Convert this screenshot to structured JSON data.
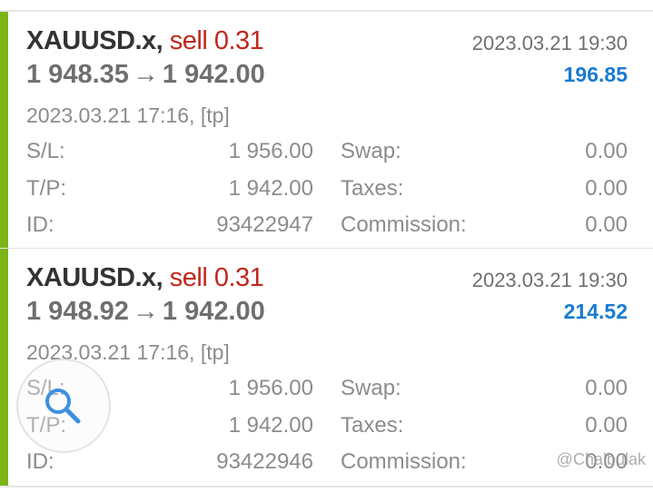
{
  "trades": [
    {
      "symbol": "XAUUSD.x,",
      "side": "sell 0.31",
      "close_time": "2023.03.21 19:30",
      "open_price": "1 948.35",
      "arrow": "→",
      "close_price": "1 942.00",
      "profit": "196.85",
      "open_info": "2023.03.21 17:16, [tp]",
      "sl_label": "S/L:",
      "sl_value": "1 956.00",
      "tp_label": "T/P:",
      "tp_value": "1 942.00",
      "id_label": "ID:",
      "id_value": "93422947",
      "swap_label": "Swap:",
      "swap_value": "0.00",
      "taxes_label": "Taxes:",
      "taxes_value": "0.00",
      "commission_label": "Commission:",
      "commission_value": "0.00"
    },
    {
      "symbol": "XAUUSD.x,",
      "side": "sell 0.31",
      "close_time": "2023.03.21 19:30",
      "open_price": "1 948.92",
      "arrow": "→",
      "close_price": "1 942.00",
      "profit": "214.52",
      "open_info": "2023.03.21 17:16, [tp]",
      "sl_label": "S/L:",
      "sl_value": "1 956.00",
      "tp_label": "T/P:",
      "tp_value": "1 942.00",
      "id_label": "ID:",
      "id_value": "93422946",
      "swap_label": "Swap:",
      "swap_value": "0.00",
      "taxes_label": "Taxes:",
      "taxes_value": "0.00",
      "commission_label": "Commission:",
      "commission_value": "0.00"
    }
  ],
  "watermark": "@Chalbulak",
  "colors": {
    "accent": "#7cb518",
    "sell": "#c0281e",
    "profit": "#1a7ad1"
  },
  "icons": {
    "zoom": "magnifier-icon"
  }
}
